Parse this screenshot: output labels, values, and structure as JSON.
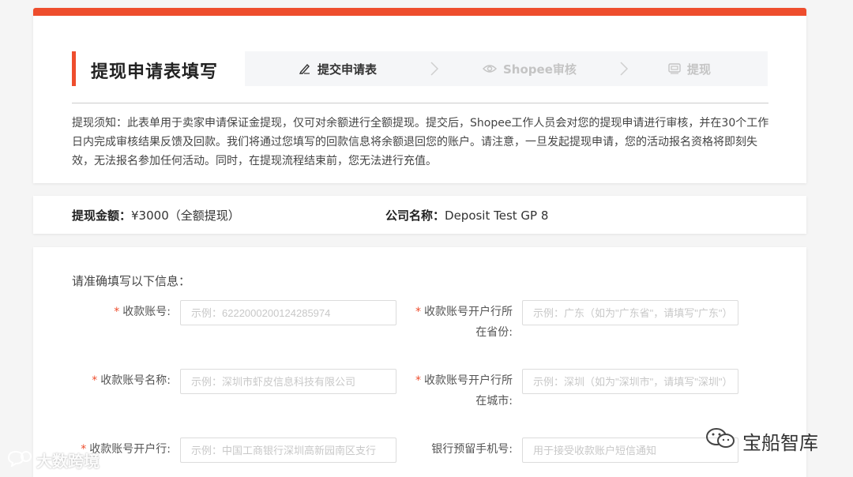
{
  "header": {
    "title": "提现申请表填写",
    "steps": [
      {
        "label": "提交申请表",
        "icon": "pencil-icon",
        "state": "active"
      },
      {
        "label": "Shopee审核",
        "icon": "eye-icon",
        "state": "inactive"
      },
      {
        "label": "提现",
        "icon": "wallet-icon",
        "state": "inactive"
      }
    ]
  },
  "notice": "提现须知：此表单用于卖家申请保证金提现，仅可对余额进行全额提现。提交后，Shopee工作人员会对您的提现申请进行审核，并在30个工作日内完成审核结果反馈及回款。我们将通过您填写的回款信息将余额退回您的账户。请注意，一旦发起提现申请，您的活动报名资格将即刻失效，无法报名参加任何活动。同时，在提现流程结束前，您无法进行充值。",
  "summary": {
    "amount_label": "提现金额：",
    "amount_value": "¥3000（全额提现）",
    "company_label": "公司名称：",
    "company_value": "Deposit Test GP 8"
  },
  "form": {
    "intro": "请准确填写以下信息：",
    "fields": {
      "account_no": {
        "label": "收款账号:",
        "placeholder": "示例：6222000200124285974",
        "required": true
      },
      "province": {
        "label_line1": "收款账号开户行所",
        "label_line2": "在省份:",
        "placeholder": "示例：广东（如为\"广东省\"，请填写\"广东\"）",
        "required": true
      },
      "account_name": {
        "label": "收款账号名称:",
        "placeholder": "示例：深圳市虾皮信息科技有限公司",
        "required": true
      },
      "city": {
        "label_line1": "收款账号开户行所",
        "label_line2": "在城市:",
        "placeholder": "示例：深圳（如为\"深圳市\"，请填写\"深圳\"）",
        "required": true
      },
      "bank": {
        "label": "收款账号开户行:",
        "placeholder": "示例：中国工商银行深圳高新园南区支行",
        "required": true
      },
      "phone": {
        "label": "银行预留手机号:",
        "placeholder": "用于接受收款账户短信通知",
        "required": false
      }
    },
    "required_mark": "*"
  },
  "watermarks": {
    "left": "大数跨境",
    "right": "宝船智库"
  },
  "colors": {
    "accent": "#ee4d2d"
  }
}
